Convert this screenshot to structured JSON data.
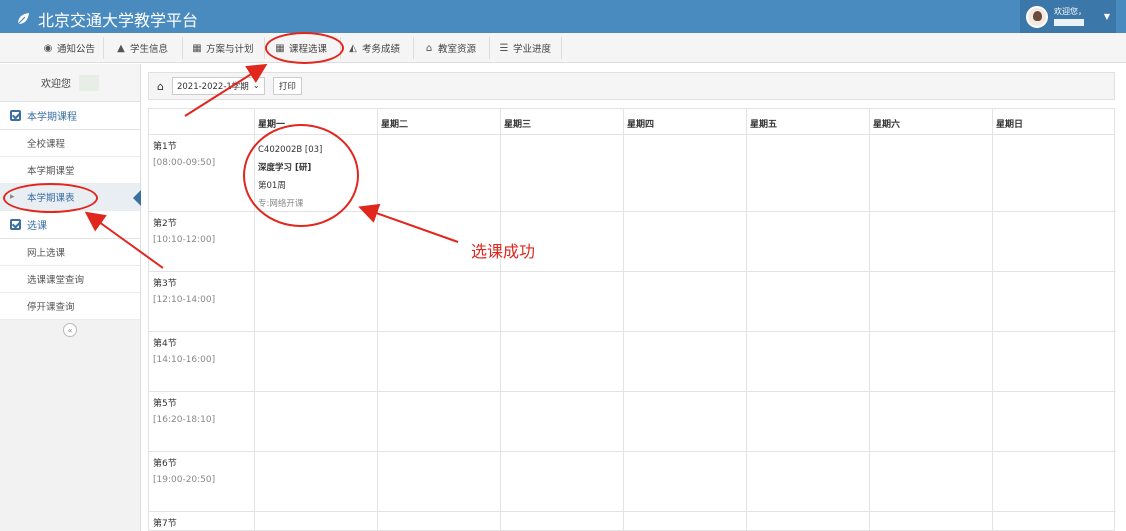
{
  "header": {
    "title": "北京交通大学教学平台",
    "user_greeting": "欢迎您，"
  },
  "nav": [
    {
      "icon": "globe-icon",
      "label": "通知公告"
    },
    {
      "icon": "graduation-cap-icon",
      "label": "学生信息"
    },
    {
      "icon": "calendar-icon",
      "label": "方案与计划"
    },
    {
      "icon": "calendar-icon",
      "label": "课程选课"
    },
    {
      "icon": "area-chart-icon",
      "label": "考务成绩"
    },
    {
      "icon": "bank-icon",
      "label": "教室资源"
    },
    {
      "icon": "list-icon",
      "label": "学业进度"
    }
  ],
  "sidebar": {
    "welcome": "欢迎您",
    "section1": "本学期课程",
    "section1_items": [
      "全校课程",
      "本学期课堂",
      "本学期课表"
    ],
    "section2": "选课",
    "section2_items": [
      "网上选课",
      "选课课堂查询",
      "停开课查询"
    ],
    "collapse_glyph": "«"
  },
  "toolbar": {
    "semester": "2021-2022-1学期",
    "print_label": "打印"
  },
  "timetable": {
    "days": [
      "星期一",
      "星期二",
      "星期三",
      "星期四",
      "星期五",
      "星期六",
      "星期日"
    ],
    "periods": [
      {
        "name": "第1节",
        "time": "[08:00-09:50]"
      },
      {
        "name": "第2节",
        "time": "[10:10-12:00]"
      },
      {
        "name": "第3节",
        "time": "[12:10-14:00]"
      },
      {
        "name": "第4节",
        "time": "[14:10-16:00]"
      },
      {
        "name": "第5节",
        "time": "[16:20-18:10]"
      },
      {
        "name": "第6节",
        "time": "[19:00-20:50]"
      },
      {
        "name": "第7节",
        "time": ""
      }
    ],
    "course": {
      "code": "C402002B [03]",
      "name": "深度学习 [研]",
      "weeks": "第01周",
      "note": "专:网络开课"
    }
  },
  "annotation": {
    "text": "选课成功",
    "color": "#e0261d"
  }
}
